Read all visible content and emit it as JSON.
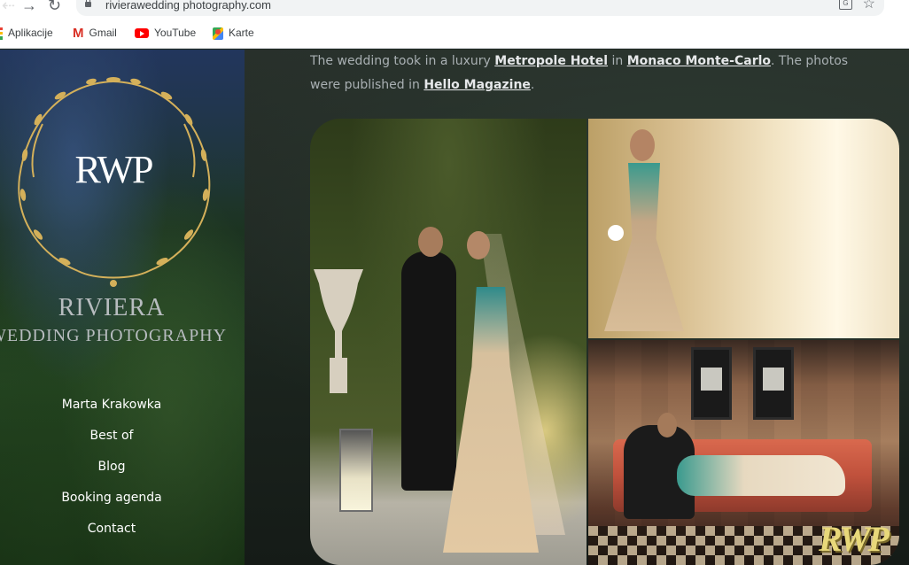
{
  "browser": {
    "url": "rivierawedding photography.com",
    "bookmarks": [
      {
        "label": "Aplikacije",
        "icon": "apps-icon"
      },
      {
        "label": "Gmail",
        "icon": "gmail-icon"
      },
      {
        "label": "YouTube",
        "icon": "youtube-icon"
      },
      {
        "label": "Karte",
        "icon": "maps-icon"
      }
    ]
  },
  "logo": {
    "monogram": "RWP",
    "title_line1": "RIVIERA",
    "title_line2": "WEDDING PHOTOGRAPHY"
  },
  "menu": [
    "Marta Krakowka",
    "Best of",
    "Blog",
    "Booking agenda",
    "Contact"
  ],
  "intro": {
    "part1": "The wedding took in a luxury ",
    "link1": "Metropole Hotel",
    "part2": " in ",
    "link2": "Monaco Monte-Carlo",
    "part3": ". The photos were published in ",
    "link3": "Hello Magazine",
    "part4": "."
  },
  "photo": {
    "watermark": "RWP"
  },
  "colors": {
    "gold": "#d4b05a",
    "menu_text": "#ffffff",
    "brand_text": "#b7bcbf"
  }
}
